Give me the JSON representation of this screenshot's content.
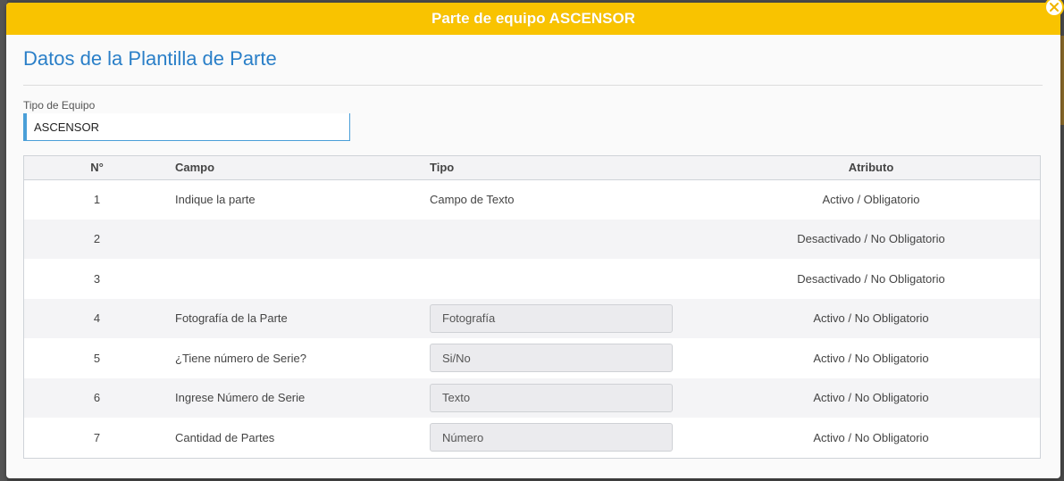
{
  "modal": {
    "title": "Parte de equipo ASCENSOR",
    "section_title": "Datos de la Plantilla de Parte"
  },
  "equipment": {
    "label": "Tipo de Equipo",
    "value": "ASCENSOR"
  },
  "table": {
    "headers": {
      "num": "N°",
      "campo": "Campo",
      "tipo": "Tipo",
      "atributo": "Atributo"
    },
    "rows": [
      {
        "num": "1",
        "campo": "Indique la parte",
        "tipo": "Campo de Texto",
        "tipo_style": "text",
        "atributo": "Activo / Obligatorio"
      },
      {
        "num": "2",
        "campo": "",
        "tipo": "",
        "tipo_style": "text",
        "atributo": "Desactivado / No Obligatorio"
      },
      {
        "num": "3",
        "campo": "",
        "tipo": "",
        "tipo_style": "text",
        "atributo": "Desactivado / No Obligatorio"
      },
      {
        "num": "4",
        "campo": "Fotografía de la Parte",
        "tipo": "Fotografía",
        "tipo_style": "pill",
        "atributo": "Activo / No Obligatorio"
      },
      {
        "num": "5",
        "campo": "¿Tiene número de Serie?",
        "tipo": "Si/No",
        "tipo_style": "pill",
        "atributo": "Activo / No Obligatorio"
      },
      {
        "num": "6",
        "campo": "Ingrese Número de Serie",
        "tipo": "Texto",
        "tipo_style": "pill",
        "atributo": "Activo / No Obligatorio"
      },
      {
        "num": "7",
        "campo": "Cantidad de Partes",
        "tipo": "Número",
        "tipo_style": "pill",
        "atributo": "Activo / No Obligatorio"
      }
    ]
  },
  "colors": {
    "header_bg": "#f9c300",
    "title_blue": "#2a7fc8",
    "field_border": "#4a9fd8"
  },
  "icons": {
    "close": "close-icon"
  }
}
